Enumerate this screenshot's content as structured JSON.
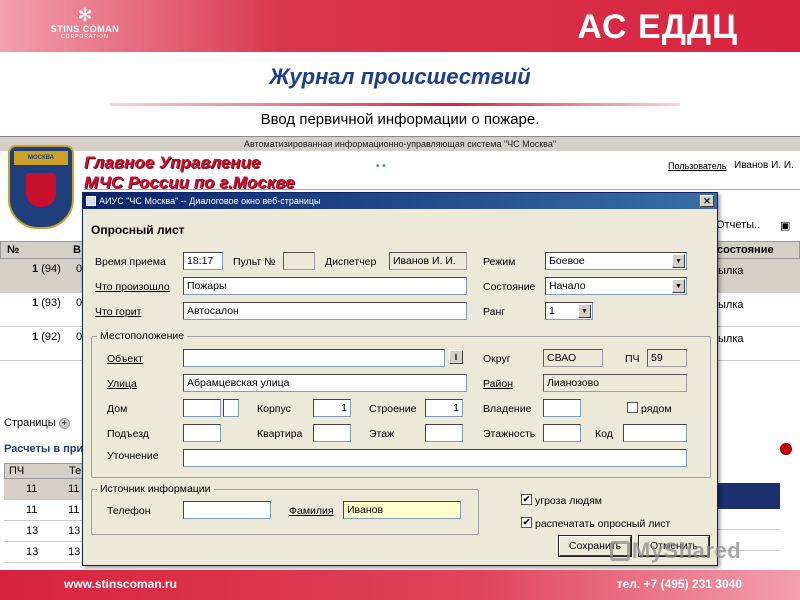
{
  "slide": {
    "logo_mark": "✻",
    "logo_name": "STINS COMAN",
    "logo_corp": "CORPORATION",
    "brand": "АС ЕДДЦ",
    "title": "Журнал происшествий",
    "subtitle": "Ввод первичной информации о пожаре.",
    "footer_site": "www.stinscoman.ru",
    "footer_phone": "тел. +7 (495) 231 3040"
  },
  "app": {
    "caption": "Автоматизированная информационно-управляющая система \"ЧС Москва\"",
    "emblem_text": "МОСКВА",
    "header_line1": "Главное Управление",
    "header_line2": "МЧС России по г.Москве",
    "dots": "•  •",
    "user_label": "Пользователь",
    "user_name": "Иванов И. И.",
    "reports": "Отчеты..",
    "reports_icon": "▣",
    "grid_left_header_a": "№",
    "grid_left_header_b": "В",
    "grid_left_rows": [
      {
        "num": "1",
        "count": "(94)",
        "extra": "0"
      },
      {
        "num": "1",
        "count": "(93)",
        "extra": "0"
      },
      {
        "num": "1",
        "count": "(92)",
        "extra": "0"
      }
    ],
    "grid_right_header": "состояние",
    "grid_right_rows": [
      "ылка",
      "ылка",
      "ылка"
    ],
    "pages_label": "Страницы",
    "pages_icon": "+",
    "calc_title": "Расчеты в при",
    "table2_header_a": "ПЧ",
    "table2_header_b": "Те",
    "table2_rows": [
      {
        "a": "11",
        "b": "11"
      },
      {
        "a": "11",
        "b": "11"
      },
      {
        "a": "13",
        "b": "13"
      },
      {
        "a": "13",
        "b": "13"
      }
    ]
  },
  "dialog": {
    "title": "АИУС \"ЧС Москва\" -- Диалоговое окно веб-страницы",
    "close_glyph": "✕",
    "form_title": "Опросный лист",
    "labels": {
      "time": "Время приема",
      "console": "Пульт №",
      "dispatcher": "Диспетчер",
      "mode": "Режим",
      "what_happened": "Что произошло",
      "state": "Состояние",
      "what_burns": "Что горит",
      "rank": "Ранг",
      "location_group": "Местоположение",
      "object": "Объект",
      "district": "Округ",
      "pch": "ПЧ",
      "street": "Улица",
      "area": "Район",
      "house": "Дом",
      "building": "Корпус",
      "structure": "Строение",
      "ownership": "Владение",
      "nearby": "рядом",
      "entrance": "Подъезд",
      "apartment": "Квартира",
      "floor": "Этаж",
      "floors_total": "Этажность",
      "code": "Код",
      "clarification": "Уточнение",
      "source_group": "Источник информации",
      "phone": "Телефон",
      "surname": "Фамилия",
      "threat": "угроза людям",
      "print_sheet": "распечатать опросный лист"
    },
    "values": {
      "time": "18:17",
      "console": "",
      "dispatcher": "Иванов И. И.",
      "mode": "Боевое",
      "what_happened": "Пожары",
      "state": "Начало",
      "what_burns": "Автосалон",
      "rank": "1",
      "object": "",
      "district": "СВАО",
      "pch": "59",
      "street": "Абрамцевская улица",
      "area": "Лианозово",
      "house": "",
      "house2": "",
      "building": "1",
      "structure": "1",
      "ownership": "",
      "entrance": "",
      "apartment": "",
      "floor": "",
      "floors_total": "",
      "code": "",
      "clarification": "",
      "phone": "",
      "surname": "Иванов"
    },
    "checks": {
      "nearby": "",
      "threat": "✔",
      "print_sheet": "✔"
    },
    "dropdown_glyph": "▼",
    "info_glyph": "i",
    "buttons": {
      "save": "Сохранить",
      "cancel": "Отменить"
    }
  },
  "watermark": "MyShared"
}
